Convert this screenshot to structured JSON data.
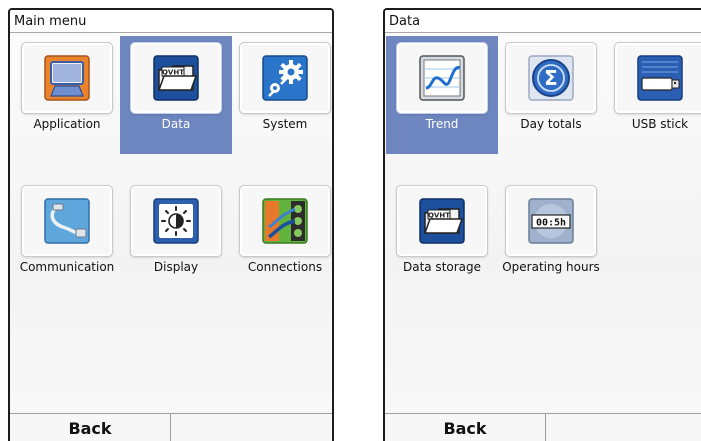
{
  "left_screen": {
    "title": "Main menu",
    "items": [
      {
        "label": "Application",
        "icon": "application-icon",
        "selected": false
      },
      {
        "label": "Data",
        "icon": "data-folder-icon",
        "selected": true
      },
      {
        "label": "System",
        "icon": "system-gear-icon",
        "selected": false
      },
      {
        "label": "Communication",
        "icon": "communication-cable-icon",
        "selected": false
      },
      {
        "label": "Display",
        "icon": "display-brightness-icon",
        "selected": false
      },
      {
        "label": "Connections",
        "icon": "connections-terminal-icon",
        "selected": false
      }
    ],
    "softkeys": {
      "left": "Back",
      "right": ""
    }
  },
  "right_screen": {
    "title": "Data",
    "items": [
      {
        "label": "Trend",
        "icon": "trend-chart-icon",
        "selected": true
      },
      {
        "label": "Day totals",
        "icon": "sigma-totals-icon",
        "selected": false
      },
      {
        "label": "USB stick",
        "icon": "usb-stick-icon",
        "selected": false
      },
      {
        "label": "Data storage",
        "icon": "data-storage-folder-icon",
        "selected": false
      },
      {
        "label": "Operating hours",
        "icon": "operating-hours-counter-icon",
        "selected": false
      }
    ],
    "softkeys": {
      "left": "Back",
      "right": ""
    }
  },
  "colors": {
    "selection": "#6e86bf",
    "brand_blue": "#1c4f9c",
    "accent_orange": "#e8782a"
  },
  "icon_text": {
    "data_folder": "QVHT",
    "operating_hours_counter": "00:5h"
  }
}
